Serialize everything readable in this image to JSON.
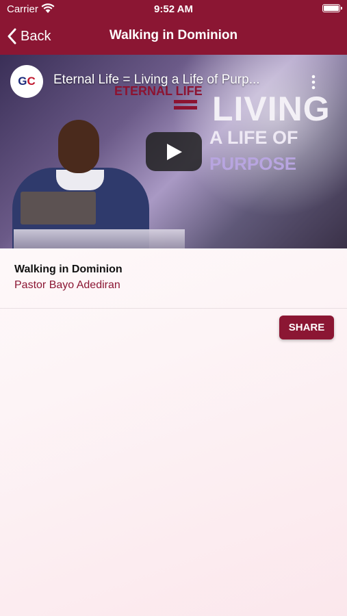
{
  "status_bar": {
    "carrier": "Carrier",
    "time": "9:52 AM"
  },
  "navbar": {
    "back_label": "Back",
    "title": "Walking in Dominion"
  },
  "video": {
    "channel_logo_text_1": "G",
    "channel_logo_text_2": "C",
    "title": "Eternal Life = Living a Life of Purp...",
    "thumbnail_text": {
      "eternal_life": "ETERNAL LIFE",
      "living": "LIVING",
      "a_life_of": "A LIFE OF",
      "purpose": "PURPOSE"
    }
  },
  "sermon": {
    "title": "Walking in Dominion",
    "author": "Pastor Bayo Adediran"
  },
  "actions": {
    "share_label": "SHARE"
  },
  "colors": {
    "brand": "#8b1633",
    "text": "#111111"
  }
}
